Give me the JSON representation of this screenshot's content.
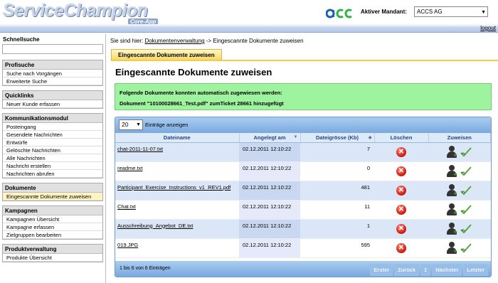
{
  "header": {
    "logo": "ServiceChampion",
    "logo_sub": "Core-App",
    "partner_logo": "acc",
    "mandant_label": "Aktiver Mandant:",
    "mandant_value": "ACCS AG",
    "logout": "logout"
  },
  "sidebar": {
    "search_title": "Schnellsuche",
    "sections": [
      {
        "title": "Profisuche",
        "items": [
          "Suche nach Vorgängen",
          "Erweiterte Suche"
        ]
      },
      {
        "title": "Quicklinks",
        "items": [
          "Neuer Kunde erfassen"
        ]
      },
      {
        "title": "Kommunikationsmodul",
        "items": [
          "Posteingang",
          "Gesendete Nachrichten",
          "Entwürfe",
          "Gelöschte Nachrichten",
          "Alle Nachrichten",
          "Nachricht erstellen",
          "Nachrichten abrufen"
        ]
      },
      {
        "title": "Dokumente",
        "items": [
          "Eingescannte Dokumente zuweisen"
        ]
      },
      {
        "title": "Kampagnen",
        "items": [
          "Kampagnen Übersicht",
          "Kampagne erfassen",
          "Zielgruppen bearbeiten"
        ]
      },
      {
        "title": "Produktverwaltung",
        "items": [
          "Produkte Übersicht"
        ]
      }
    ]
  },
  "breadcrumb": {
    "prefix": "Sie sind hier:",
    "link": "Dokumentenverwaltung",
    "separator": "->",
    "current": "Eingescannte Dokumente zuweisen"
  },
  "tab": {
    "label": "Eingescannte Dokumente zuweisen"
  },
  "main": {
    "title": "Eingescannte Dokumente zuweisen",
    "message_line1": "Folgende Dokumente konnten automatisch zugewiesen werden:",
    "message_line2": "Dokument \"10100028661_Test.pdf\" zumTicket 28661 hinzugefügt"
  },
  "grid": {
    "length_value": "20",
    "length_label": "Einträge anzeigen",
    "columns": [
      "Dateiname",
      "Angelegt am",
      "Dateigrösse (Kb)",
      "Löschen",
      "Zuweisen"
    ],
    "rows": [
      {
        "file": "chat-2011-11-07.txt",
        "date": "02.12.2011 12:10:22",
        "size": "7"
      },
      {
        "file": "readme.txt",
        "date": "02.12.2011 12:10:22",
        "size": "0"
      },
      {
        "file": "Participant_Exercise_Instructions_v1_REV1.pdf",
        "date": "02.12.2011 12:10:22",
        "size": "481"
      },
      {
        "file": "Chat.txt",
        "date": "02.12.2011 12:10:22",
        "size": "11"
      },
      {
        "file": "Ausschreibung_Angebot_DE.txt",
        "date": "02.12.2011 12:10:22",
        "size": "1"
      },
      {
        "file": "019.JPG",
        "date": "02.12.2011 12:10:22",
        "size": "595"
      }
    ],
    "info": "1 bis 6 von 6 Einträgen",
    "pager": [
      "Erster",
      "Zurück",
      "1",
      "Nächster",
      "Letzter"
    ]
  }
}
